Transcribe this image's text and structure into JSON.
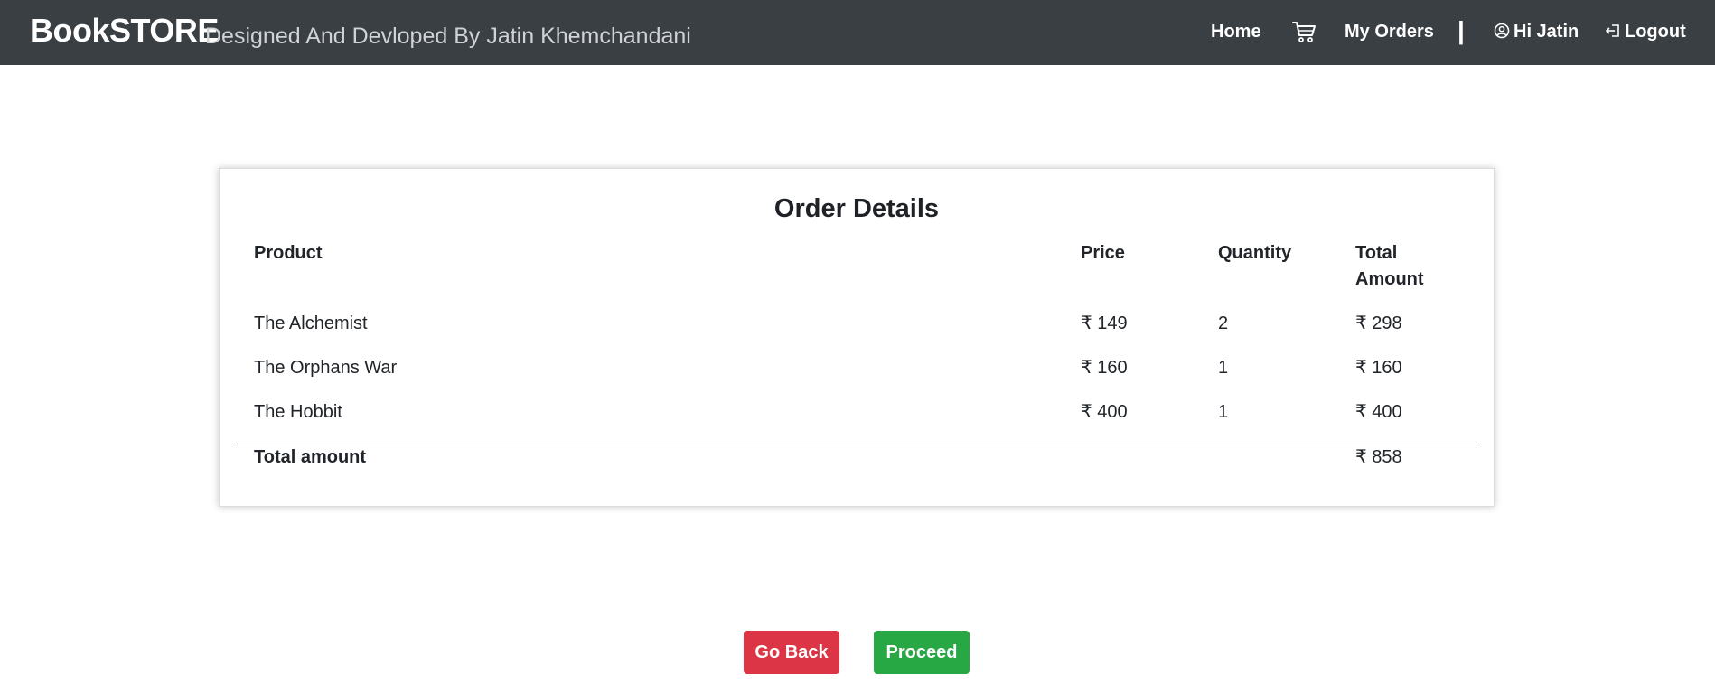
{
  "navbar": {
    "brand": "BookSTORE",
    "tagline": "Designed And Devloped By Jatin Khemchandani",
    "home": "Home",
    "my_orders": "My Orders",
    "separator": "|",
    "user_greeting": "Hi Jatin",
    "logout": "Logout",
    "icons": {
      "cart": "cart-icon",
      "user": "user-circle-icon",
      "logout": "logout-icon"
    },
    "background": "#3a3f44"
  },
  "order": {
    "title": "Order Details",
    "headers": {
      "product": "Product",
      "price": "Price",
      "quantity": "Quantity",
      "total_line1": "Total",
      "total_line2": "Amount"
    },
    "rows": [
      {
        "product": "The Alchemist",
        "price": "₹ 149",
        "quantity": "2",
        "total": "₹ 298"
      },
      {
        "product": "The Orphans War",
        "price": "₹ 160",
        "quantity": "1",
        "total": "₹ 160"
      },
      {
        "product": "The Hobbit",
        "price": "₹ 400",
        "quantity": "1",
        "total": "₹ 400"
      }
    ],
    "total_label": "Total amount",
    "total_value": "₹ 858"
  },
  "actions": {
    "back": "Go Back",
    "proceed": "Proceed",
    "colors": {
      "back": "#dc3545",
      "proceed": "#28a745"
    }
  }
}
